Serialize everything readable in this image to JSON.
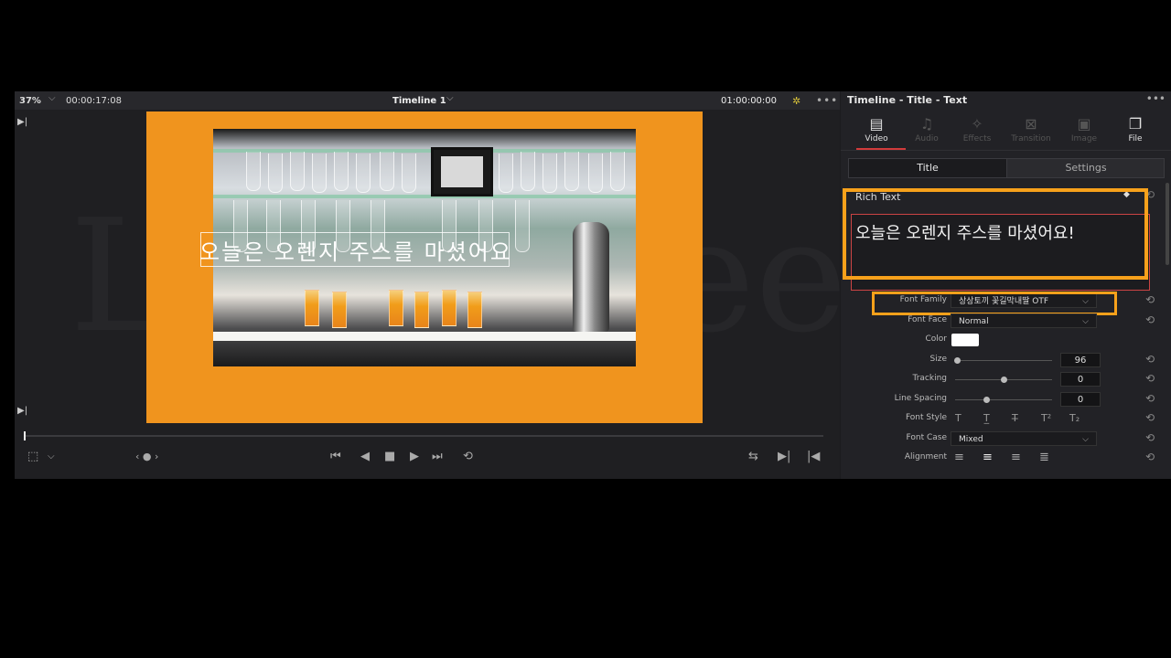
{
  "viewer": {
    "zoom": "37%",
    "timecode": "00:00:17:08",
    "timeline_name": "Timeline 1",
    "record_timecode": "01:00:00:00",
    "overlay_text": "오늘은 오렌지 주스를 마셨어요",
    "watermark": "Lovestreet",
    "transport": {
      "first_frame": "⏮",
      "reverse": "◀",
      "stop": "■",
      "play": "▶",
      "last_frame": "⏭",
      "loop": "⟲"
    },
    "jog_labels": "‹ ● ›"
  },
  "inspector": {
    "title": "Timeline - Title - Text",
    "tabs": [
      {
        "label": "Video",
        "icon": "film-icon",
        "active": true
      },
      {
        "label": "Audio",
        "icon": "music-note-icon",
        "active": false
      },
      {
        "label": "Effects",
        "icon": "magic-wand-icon",
        "active": false
      },
      {
        "label": "Transition",
        "icon": "transition-icon",
        "active": false
      },
      {
        "label": "Image",
        "icon": "image-icon",
        "active": false
      },
      {
        "label": "File",
        "icon": "file-icon",
        "active": false
      }
    ],
    "segments": [
      "Title",
      "Settings"
    ],
    "rich_text_label": "Rich Text",
    "rich_text_value": "오늘은 오렌지 주스를 마셨어요!",
    "font_family_label": "Font Family",
    "font_family_value": "상상토끼 꽃길막내딸 OTF",
    "font_face_label": "Font Face",
    "font_face_value": "Normal",
    "color_label": "Color",
    "color_value": "#ffffff",
    "size_label": "Size",
    "size_value": "96",
    "tracking_label": "Tracking",
    "tracking_value": "0",
    "line_spacing_label": "Line Spacing",
    "line_spacing_value": "0",
    "font_style_label": "Font Style",
    "font_case_label": "Font Case",
    "font_case_value": "Mixed",
    "alignment_label": "Alignment",
    "highlight_color": "#f7a11b"
  }
}
